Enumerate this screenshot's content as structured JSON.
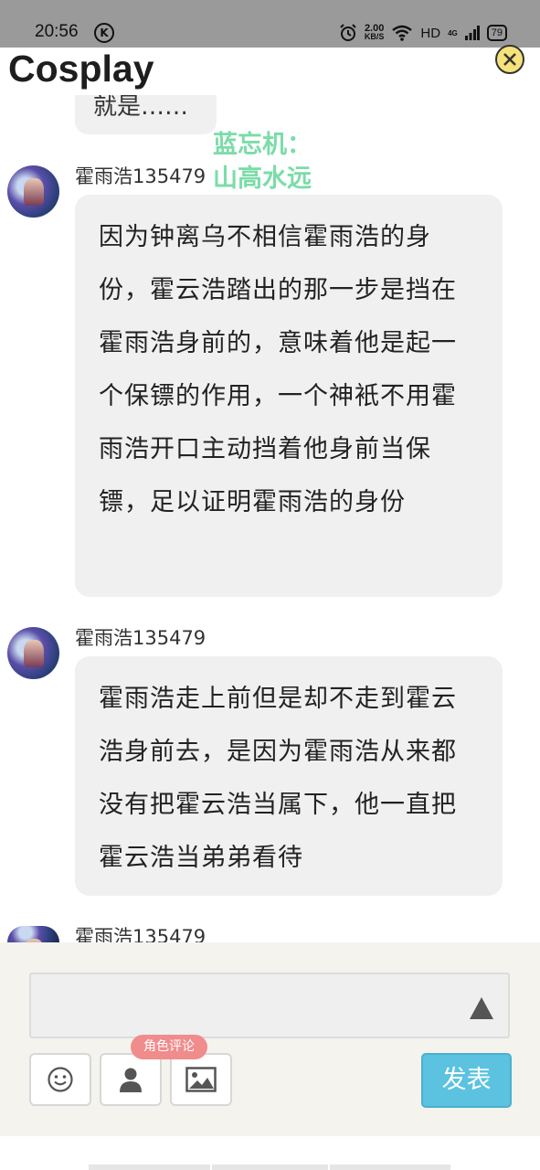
{
  "status_bar": {
    "time": "20:56",
    "k_icon": "K",
    "speed_value": "2.00",
    "speed_unit": "KB/S",
    "hd": "HD",
    "network": "4G",
    "battery": "79",
    "icons": [
      "alarm-icon",
      "wifi-icon",
      "signal-icon",
      "battery-icon"
    ]
  },
  "header": {
    "title": "Cosplay",
    "close_icon": "close-icon",
    "close_color": "#f6e27a"
  },
  "partial_message": {
    "text": "就是……"
  },
  "overlay": {
    "line1": "蓝忘机：",
    "line2": "山高水远",
    "color": "#7bdca8"
  },
  "messages": [
    {
      "username": "霍雨浩135479",
      "text": "因为钟离乌不相信霍雨浩的身份，霍云浩踏出的那一步是挡在霍雨浩身前的，意味着他是起一个保镖的作用，一个神衹不用霍雨浩开口主动挡着他身前当保镖，足以证明霍雨浩的身份"
    },
    {
      "username": "霍雨浩135479",
      "text": "霍雨浩走上前但是却不走到霍云浩身前去，是因为霍雨浩从来都没有把霍云浩当属下，他一直把霍云浩当弟弟看待"
    },
    {
      "username": "霍雨浩135479",
      "text": ""
    }
  ],
  "composer": {
    "input_value": "",
    "send_icon": "triangle-up-icon",
    "tools": [
      "emoji-icon",
      "person-icon",
      "image-icon"
    ],
    "role_badge": "角色评论",
    "post_label": "发表",
    "post_color": "#5bc2e0",
    "badge_color": "#f08c8c"
  }
}
